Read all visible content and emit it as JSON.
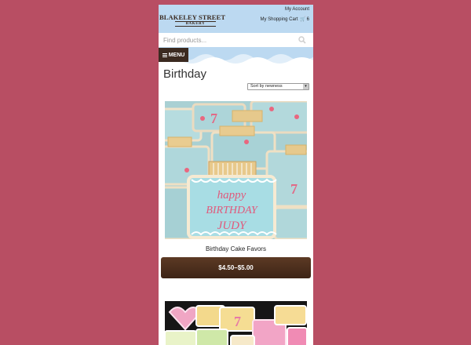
{
  "header": {
    "logo_line1": "BLAKELEY STREET",
    "logo_line2": "BAKERY",
    "account_label": "My Account",
    "cart_label": "My Shopping Cart",
    "cart_count": "6"
  },
  "search": {
    "placeholder": "Find products..."
  },
  "nav": {
    "menu_label": "MENU"
  },
  "page": {
    "title": "Birthday"
  },
  "sort": {
    "selected": "Sort by newness"
  },
  "products": [
    {
      "name": "Birthday Cake Favors",
      "price": "$4.50–$5.00",
      "cookie_text": [
        "happy",
        "BIRTHDAY",
        "JUDY"
      ],
      "candle_number": "7"
    }
  ],
  "colors": {
    "page_bg": "#b84e63",
    "header_bg": "#bcd9f1",
    "brand_brown": "#3b2a20",
    "button_brown": "#4a2e1d"
  }
}
